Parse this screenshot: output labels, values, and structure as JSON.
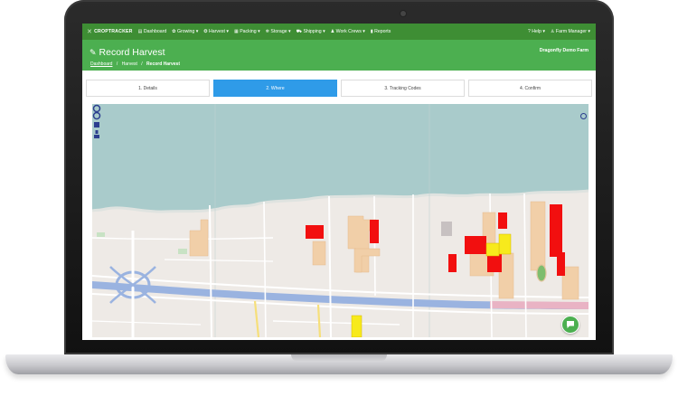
{
  "brand": {
    "name": "CROPTRACKER",
    "icon": "croptracker-logo-icon"
  },
  "nav": {
    "items": [
      {
        "label": "Dashboard",
        "icon": "dashboard-icon",
        "glyph": "▤"
      },
      {
        "label": "Growing",
        "icon": "growing-icon",
        "glyph": "✿"
      },
      {
        "label": "Harvest",
        "icon": "harvest-icon",
        "glyph": "❂"
      },
      {
        "label": "Packing",
        "icon": "packing-icon",
        "glyph": "▦"
      },
      {
        "label": "Storage",
        "icon": "storage-icon",
        "glyph": "❄"
      },
      {
        "label": "Shipping",
        "icon": "shipping-icon",
        "glyph": "⛟"
      },
      {
        "label": "Work Crews",
        "icon": "work-crews-icon",
        "glyph": "♟"
      },
      {
        "label": "Reports",
        "icon": "reports-icon",
        "glyph": "▮"
      }
    ],
    "right": [
      {
        "label": "Help",
        "icon": "help-icon",
        "glyph": "?"
      },
      {
        "label": "Farm Manager",
        "icon": "user-icon",
        "glyph": "♙"
      }
    ]
  },
  "header": {
    "title": "Record Harvest",
    "farm": "Dragonfly Demo Farm",
    "breadcrumb": {
      "home": "Dashboard",
      "section": "Harvest",
      "current": "Record Harvest"
    }
  },
  "steps": [
    {
      "label": "1. Details",
      "active": false
    },
    {
      "label": "2. Where",
      "active": true
    },
    {
      "label": "3. Tracking Codes",
      "active": false
    },
    {
      "label": "4. Confirm",
      "active": false
    }
  ],
  "map": {
    "colors": {
      "water": "#a9cbcb",
      "land": "#eeeae6",
      "field_beige": "#f1cfa8",
      "field_red": "#f20f0f",
      "field_yellow": "#f7ea1c",
      "highway": "#9ab3e0",
      "road": "#ffffff",
      "track": "#7dbd6e"
    }
  },
  "colors": {
    "navbar": "#3e8e34",
    "header": "#4caf50",
    "active_step": "#2f9be8"
  }
}
